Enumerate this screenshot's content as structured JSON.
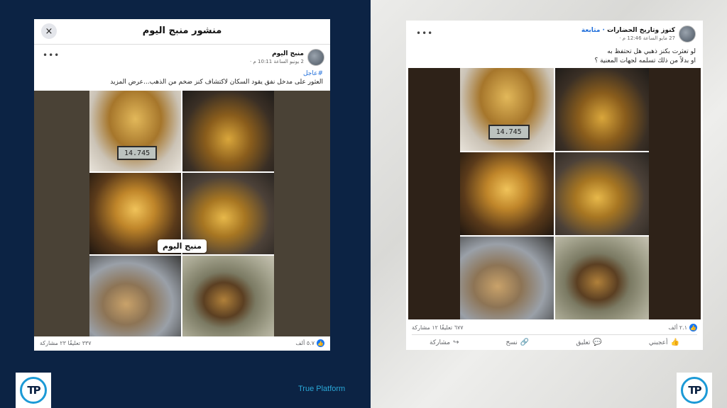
{
  "left_post": {
    "header_title": "منشور منبج اليوم",
    "close_icon": "×",
    "author": "منبج اليوم",
    "meta": "2 يونيو الساعة 10:11 م · ",
    "hashtag": "#عاجل",
    "text": "العثور على مدخل نفق يقود السكان لاكتشاف كنز ضخم من الذهب...عرض المزيد",
    "image_label": "منبج اليوم",
    "scale_readout": "14.745",
    "likes": "٥.٧ ألف",
    "comments_shares": "٣٣٧ تعليقًا  ٢٣ مشاركة",
    "more_icon": "•••"
  },
  "right_post": {
    "author": "كنوز وتاريخ الحضارات",
    "follow": " · متابعة",
    "meta": "27 مايو الساعة 12:46 م · ",
    "text_line1": "لو تعثرت بكنز ذهبي هل تحتفظ به",
    "text_line2": "او بدلاً من ذلك تسلمه لجهات المعنية ؟",
    "scale_readout": "14.745",
    "likes": "٢.١ ألف",
    "comments_shares": "٦٧٧ تعليقًا  ١٢ مشاركة",
    "more_icon": "•••",
    "actions": {
      "like": "أعجبني",
      "comment": "تعليق",
      "copy": "نسخ",
      "share": "مشاركة"
    }
  },
  "brand": {
    "name": "True Platform",
    "logo_text": "TP"
  },
  "colors": {
    "left_bg": "#0c2344",
    "accent": "#1877f2",
    "brand": "#2aa8d8"
  }
}
